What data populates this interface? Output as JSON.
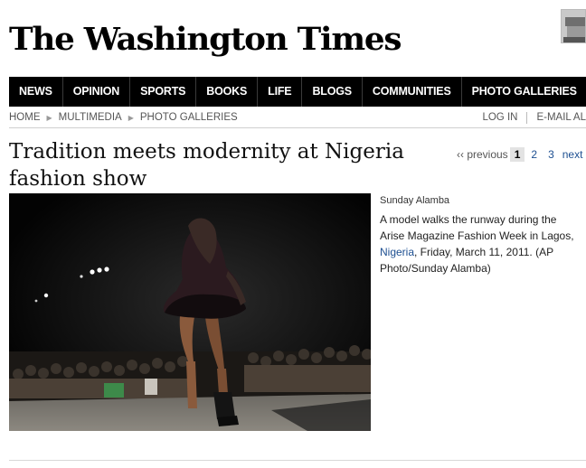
{
  "site": {
    "logo_text": "The Washington Times"
  },
  "nav": {
    "items": [
      "NEWS",
      "OPINION",
      "SPORTS",
      "BOOKS",
      "LIFE",
      "BLOGS",
      "COMMUNITIES",
      "PHOTO GALLERIES"
    ]
  },
  "breadcrumb": {
    "items": [
      "HOME",
      "MULTIMEDIA",
      "PHOTO GALLERIES"
    ],
    "login": "LOG IN",
    "email": "E-MAIL AL"
  },
  "article": {
    "headline": "Tradition meets modernity at Nigeria fashion show"
  },
  "pager": {
    "previous": "‹‹ previous",
    "pages": [
      "1",
      "2",
      "3"
    ],
    "current_page": "1",
    "next": "next ››"
  },
  "photo": {
    "credit": "Sunday Alamba",
    "caption_before": "A model walks the runway during the Arise Magazine Fashion Week in Lagos, ",
    "caption_link": "Nigeria",
    "caption_after": ", Friday, March 11, 2011. (AP Photo/Sunday Alamba)"
  },
  "colors": {
    "nav_bg": "#000000",
    "link": "#1d4f91",
    "current_page_bg": "#e3e3e3"
  }
}
